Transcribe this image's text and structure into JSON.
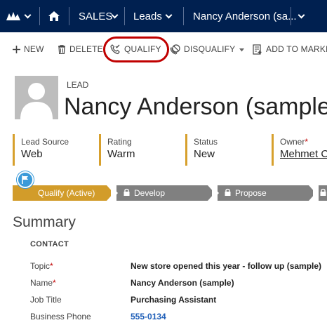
{
  "topnav": {
    "module": "SALES",
    "entity": "Leads",
    "record": "Nancy Anderson (sa..."
  },
  "commands": {
    "new": "NEW",
    "delete": "DELETE",
    "qualify": "QUALIFY",
    "disqualify": "DISQUALIFY",
    "add_to_marketing": "ADD TO MARKETI"
  },
  "header": {
    "entity_label": "LEAD",
    "name": "Nancy Anderson (sample"
  },
  "header_fields": [
    {
      "label": "Lead Source",
      "value": "Web"
    },
    {
      "label": "Rating",
      "value": "Warm"
    },
    {
      "label": "Status",
      "value": "New"
    },
    {
      "label": "Owner",
      "value": "Mehmet C"
    }
  ],
  "process": {
    "stages": [
      {
        "label": "Qualify (Active)",
        "active": true
      },
      {
        "label": "Develop",
        "active": false
      },
      {
        "label": "Propose",
        "active": false
      }
    ]
  },
  "summary": {
    "title": "Summary",
    "section": "CONTACT",
    "fields": [
      {
        "label": "Topic",
        "value": "New store opened this year - follow up (sample)",
        "required": true
      },
      {
        "label": "Name",
        "value": "Nancy Anderson (sample)",
        "required": true
      },
      {
        "label": "Job Title",
        "value": "Purchasing Assistant",
        "required": false
      },
      {
        "label": "Business Phone",
        "value": "555-0134",
        "required": false
      }
    ]
  },
  "colors": {
    "nav_bg": "#002050",
    "accent": "#d29c2a",
    "required": "#c00000",
    "highlight_ring": "#c00000",
    "link": "#1f5fb8"
  }
}
